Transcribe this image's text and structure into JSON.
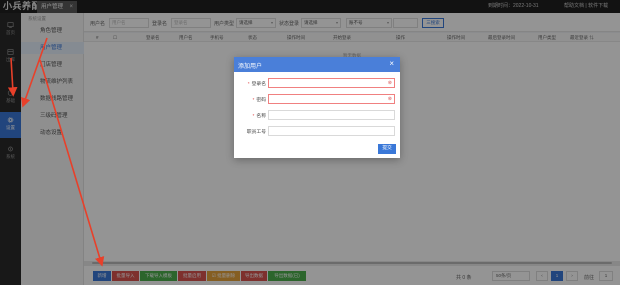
{
  "app": {
    "logo": "小兵养配"
  },
  "top_tab": {
    "label": "用户管理",
    "close": "×"
  },
  "top_right": {
    "expiry": "到期时间：2022-10-31",
    "links": "帮助文档 | 软件下载"
  },
  "rail": [
    {
      "label": "首页",
      "icon": "home-icon"
    },
    {
      "label": "出库",
      "icon": "outbound-icon"
    },
    {
      "label": "基础",
      "icon": "base-icon"
    },
    {
      "label": "设置",
      "icon": "gear-icon",
      "active": true
    },
    {
      "label": "系统",
      "icon": "system-icon"
    }
  ],
  "subnav": {
    "title": "系统设置",
    "items": [
      {
        "label": "角色管理"
      },
      {
        "label": "用户管理",
        "active": true
      },
      {
        "label": "门店管理"
      },
      {
        "label": "物流维护列表"
      },
      {
        "label": "数据线路管理"
      },
      {
        "label": "三级码管理"
      },
      {
        "label": "动态设置"
      }
    ]
  },
  "filters": {
    "user_label": "用户名",
    "user_placeholder": "用户名",
    "login_label": "登录名",
    "login_placeholder": "登录名",
    "type_label": "用户类型",
    "type_value": "请选择",
    "status_label": "状态登录",
    "status_value": "请选择",
    "more_label": "账不号",
    "search_button": "三搜索"
  },
  "table": {
    "headers": [
      "#",
      "☐",
      "登录名",
      "用户名",
      "手机号",
      "状态",
      "操作时间",
      "开始登录",
      "操作",
      "操作时间",
      "最后登录时间",
      "用户类型",
      "最近登录 ⇅"
    ],
    "empty_text": "暂无数据"
  },
  "bottom_buttons": [
    {
      "label": "新增",
      "color": "#3a78d8"
    },
    {
      "label": "批量导入",
      "color": "#d9534f"
    },
    {
      "label": "下载导入模板",
      "color": "#4cae4c"
    },
    {
      "label": "批量启用",
      "color": "#d9534f"
    },
    {
      "label": "☑ 批量删除",
      "color": "#e6a23c"
    },
    {
      "label": "导出数据",
      "color": "#d9534f"
    },
    {
      "label": "导出数据(已)",
      "color": "#4cae4c"
    }
  ],
  "pagination": {
    "total": "共 0 条",
    "page_size": "50条/页",
    "prev": "‹",
    "current": "1",
    "next": "›",
    "goto": "前往",
    "goto_value": "1"
  },
  "modal": {
    "title": "添加用户",
    "close": "×",
    "fields": [
      {
        "label": "登录名",
        "required": true,
        "error": true
      },
      {
        "label": "密码",
        "required": true,
        "error": true
      },
      {
        "label": "名称",
        "required": true,
        "error": false
      },
      {
        "label": "职员工号",
        "required": false,
        "error": false
      }
    ],
    "submit": "提交"
  },
  "colors": {
    "accent": "#3a78d8",
    "annotation": "#e8402a"
  }
}
